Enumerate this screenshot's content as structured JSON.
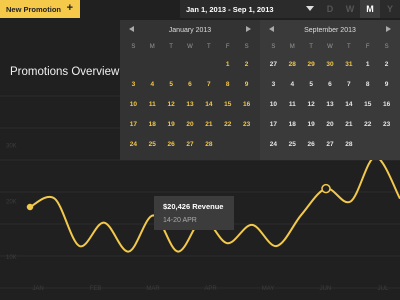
{
  "toolbar": {
    "new_promotion_label": "New Promotion",
    "new_promotion_icon": "+",
    "date_range_label": "Jan 1, 2013 - Sep 1, 2013",
    "range_buttons": [
      "D",
      "W",
      "M",
      "Y"
    ],
    "active_range": "M"
  },
  "page": {
    "title": "Promotions Overview"
  },
  "calendars": [
    {
      "month_label": "January 2013",
      "weekdays": [
        "S",
        "M",
        "T",
        "W",
        "T",
        "F",
        "S"
      ],
      "weeks": [
        [
          "",
          "",
          "",
          "",
          "",
          "1",
          "2"
        ],
        [
          "3",
          "4",
          "5",
          "6",
          "7",
          "8",
          "9"
        ],
        [
          "10",
          "11",
          "12",
          "13",
          "14",
          "15",
          "16"
        ],
        [
          "17",
          "18",
          "19",
          "20",
          "21",
          "22",
          "23"
        ],
        [
          "24",
          "25",
          "26",
          "27",
          "28",
          "",
          ""
        ]
      ]
    },
    {
      "month_label": "September 2013",
      "weekdays": [
        "S",
        "M",
        "T",
        "W",
        "T",
        "F",
        "S"
      ],
      "weeks": [
        [
          "27",
          "28",
          "29",
          "30",
          "31",
          "1",
          "2"
        ],
        [
          "3",
          "4",
          "5",
          "6",
          "7",
          "8",
          "9"
        ],
        [
          "10",
          "11",
          "12",
          "13",
          "14",
          "15",
          "16"
        ],
        [
          "17",
          "18",
          "19",
          "20",
          "21",
          "22",
          "23"
        ],
        [
          "24",
          "25",
          "26",
          "27",
          "28",
          "",
          ""
        ]
      ]
    }
  ],
  "tooltip": {
    "value": "$20,426 Revenue",
    "date": "14-20 APR"
  },
  "chart_data": {
    "type": "line",
    "x": [
      "JAN",
      "FEB",
      "MAR",
      "APR",
      "MAY",
      "JUN",
      "JUL"
    ],
    "y_ticks": [
      "10K",
      "20K",
      "30K"
    ],
    "ylim": [
      5000,
      40000
    ],
    "grid": true,
    "series": [
      {
        "values": [
          19000,
          20500,
          12000,
          16200,
          11000,
          17500,
          11000,
          16800,
          12500,
          15800,
          12000,
          17600,
          22300,
          20000,
          28000,
          20500
        ]
      }
    ],
    "highlight_points": [
      0,
      12
    ],
    "colors": {
      "line": "#f2c94c",
      "grid": "#2c2c2c",
      "axis_text": "#3d3d3d"
    }
  }
}
